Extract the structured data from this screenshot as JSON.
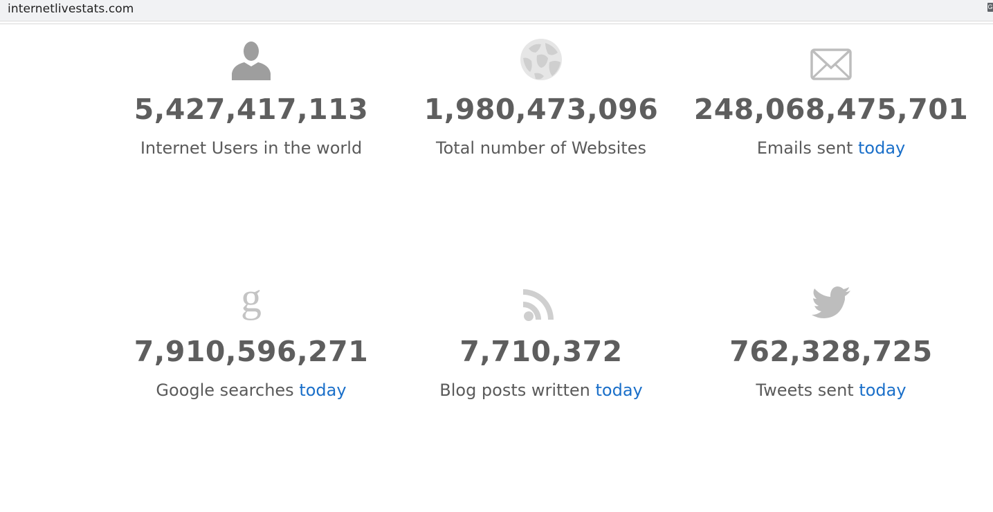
{
  "browser": {
    "url": "internetlivestats.com",
    "extension_icon": "G"
  },
  "stats": [
    {
      "icon": "user-icon",
      "number": "5,427,417,113",
      "label": "Internet Users in the world",
      "link": ""
    },
    {
      "icon": "globe-icon",
      "number": "1,980,473,096",
      "label": "Total number of Websites",
      "link": ""
    },
    {
      "icon": "envelope-icon",
      "number": "248,068,475,701",
      "label": "Emails sent ",
      "link": "today"
    },
    {
      "icon": "google-icon",
      "number": "7,910,596,271",
      "label": "Google searches ",
      "link": "today"
    },
    {
      "icon": "rss-icon",
      "number": "7,710,372",
      "label": "Blog posts written ",
      "link": "today"
    },
    {
      "icon": "twitter-bird-icon",
      "number": "762,328,725",
      "label": "Tweets sent ",
      "link": "today"
    }
  ],
  "colors": {
    "number": "#5e5e5e",
    "label": "#5a5a5a",
    "link": "#1a6fc9",
    "icon": "#bdbdbd"
  }
}
